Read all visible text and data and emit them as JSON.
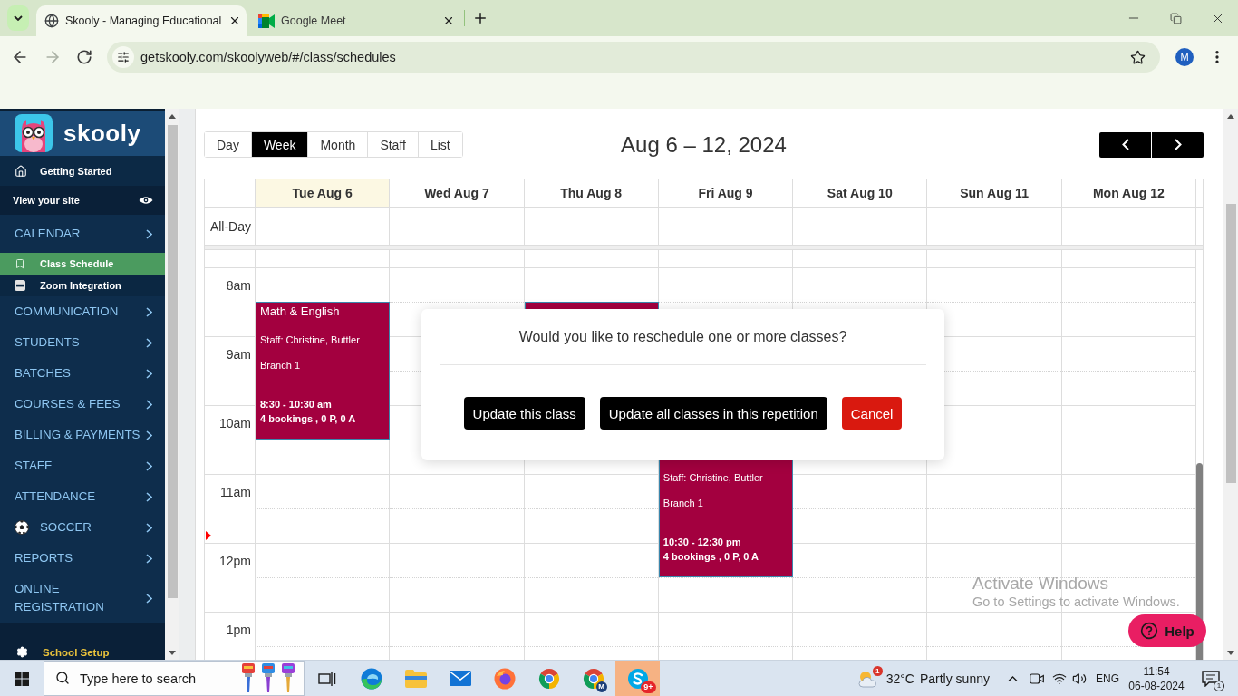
{
  "browser": {
    "tabs": [
      {
        "title": "Skooly - Managing Educational",
        "selected": true
      },
      {
        "title": "Google Meet",
        "selected": false
      }
    ],
    "url": "getskooly.com/skoolyweb/#/class/schedules",
    "forward_disabled": true,
    "profile": "M"
  },
  "sidebar": {
    "brand": "skooly",
    "items": [
      {
        "kind": "link",
        "label": "Getting Started"
      },
      {
        "kind": "site",
        "label": "View your site"
      },
      {
        "kind": "section",
        "label": "CALENDAR",
        "children": [
          {
            "label": "Class Schedule",
            "selected": true
          },
          {
            "label": "Zoom Integration",
            "selected": false
          }
        ]
      },
      {
        "kind": "section",
        "label": "COMMUNICATION"
      },
      {
        "kind": "section",
        "label": "STUDENTS"
      },
      {
        "kind": "section",
        "label": "BATCHES"
      },
      {
        "kind": "section",
        "label": "COURSES & FEES"
      },
      {
        "kind": "section",
        "label": "BILLING & PAYMENTS"
      },
      {
        "kind": "section",
        "label": "STAFF"
      },
      {
        "kind": "section",
        "label": "ATTENDANCE"
      },
      {
        "kind": "sport",
        "label": "SOCCER"
      },
      {
        "kind": "section",
        "label": "REPORTS"
      },
      {
        "kind": "section",
        "label": "ONLINE REGISTRATION"
      },
      {
        "kind": "setup",
        "label": "School Setup"
      }
    ]
  },
  "schedule": {
    "views": [
      {
        "label": "Day",
        "selected": false
      },
      {
        "label": "Week",
        "selected": true
      },
      {
        "label": "Month",
        "selected": false
      },
      {
        "label": "Staff",
        "selected": false
      },
      {
        "label": "List",
        "selected": false
      }
    ],
    "title": "Aug 6 – 12, 2024"
  },
  "calendar": {
    "all_day_label": "All-Day",
    "hours": [
      "8am",
      "9am",
      "10am",
      "11am",
      "12pm",
      "1pm"
    ],
    "days": [
      {
        "label": "Tue Aug 6",
        "today": true,
        "events": [
          {
            "kind": "class",
            "title": "Math & English",
            "staff": "Staff: Christine, Buttler",
            "branch": "Branch 1",
            "time": "8:30 - 10:30 am",
            "bookings": "4 bookings , 0 P, 0 A"
          }
        ]
      },
      {
        "label": "Wed Aug 7",
        "today": false
      },
      {
        "label": "Thu Aug 8",
        "today": false,
        "events": [
          {
            "kind": "covered"
          }
        ]
      },
      {
        "label": "Fri Aug 9",
        "today": false,
        "events": [
          {
            "kind": "class",
            "staff": "Staff: Christine, Buttler",
            "branch": "Branch 1",
            "time": "10:30 - 12:30 pm",
            "bookings": "4 bookings , 0 P, 0 A"
          }
        ]
      },
      {
        "label": "Sat Aug 10",
        "today": false
      },
      {
        "label": "Sun Aug 11",
        "today": false
      },
      {
        "label": "Mon Aug 12",
        "today": false
      }
    ]
  },
  "dialog": {
    "message": "Would you like to reschedule one or more classes?",
    "buttons": [
      {
        "label": "Update this class",
        "kind": "primary"
      },
      {
        "label": "Update all classes in this repetition",
        "kind": "primary"
      },
      {
        "label": "Cancel",
        "kind": "danger"
      }
    ]
  },
  "help": {
    "label": "Help"
  },
  "os_notice": {
    "title": "Activate Windows",
    "subtitle": "Go to Settings to activate Windows."
  },
  "taskbar": {
    "search_placeholder": "Type here to search",
    "apps": [
      {
        "kind": "taskview",
        "selected": false
      },
      {
        "kind": "edge",
        "selected": false
      },
      {
        "kind": "explorer",
        "selected": false
      },
      {
        "kind": "mail",
        "selected": false
      },
      {
        "kind": "firefox",
        "selected": false
      },
      {
        "kind": "chrome",
        "selected": false
      },
      {
        "kind": "chrome-profile",
        "badge": "M",
        "selected": false
      },
      {
        "kind": "skype",
        "badge": "9+",
        "selected": true
      }
    ],
    "weather": {
      "badge": "1",
      "temperature": "32°C",
      "condition": "Partly sunny"
    },
    "language": "ENG",
    "time": "11:54",
    "date": "06-08-2024",
    "notifications": "1"
  }
}
